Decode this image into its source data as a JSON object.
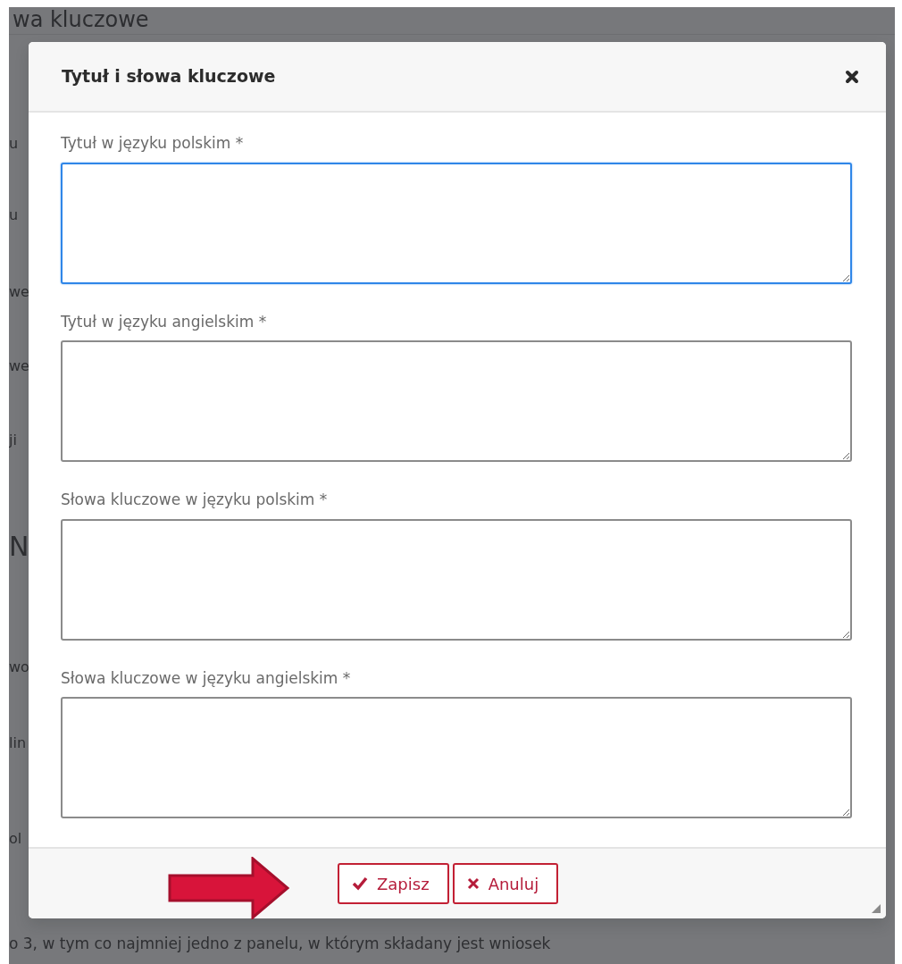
{
  "background": {
    "heading": "wa kluczowe",
    "fragments": [
      {
        "kind": "text",
        "text": "u"
      },
      {
        "kind": "text",
        "text": "u"
      },
      {
        "kind": "text",
        "text": "we"
      },
      {
        "kind": "text",
        "text": "we"
      },
      {
        "kind": "text",
        "text": "ji"
      },
      {
        "kind": "heading",
        "text": "N"
      },
      {
        "kind": "text",
        "text": "wo"
      },
      {
        "kind": "text",
        "text": "lin"
      },
      {
        "kind": "text",
        "text": "ol"
      }
    ],
    "footer_text": "o 3, w tym co najmniej jedno z panelu, w którym składany jest wniosek"
  },
  "dialog": {
    "title": "Tytuł i słowa kluczowe",
    "fields": [
      {
        "label": "Tytuł w języku polskim *",
        "focused": true
      },
      {
        "label": "Tytuł w języku angielskim *",
        "focused": false
      },
      {
        "label": "Słowa kluczowe w języku polskim *",
        "focused": false
      },
      {
        "label": "Słowa kluczowe w języku angielskim *",
        "focused": false
      }
    ],
    "buttons": [
      {
        "kind": "save",
        "label": "Zapisz"
      },
      {
        "kind": "cancel",
        "label": "Anuluj"
      }
    ]
  }
}
